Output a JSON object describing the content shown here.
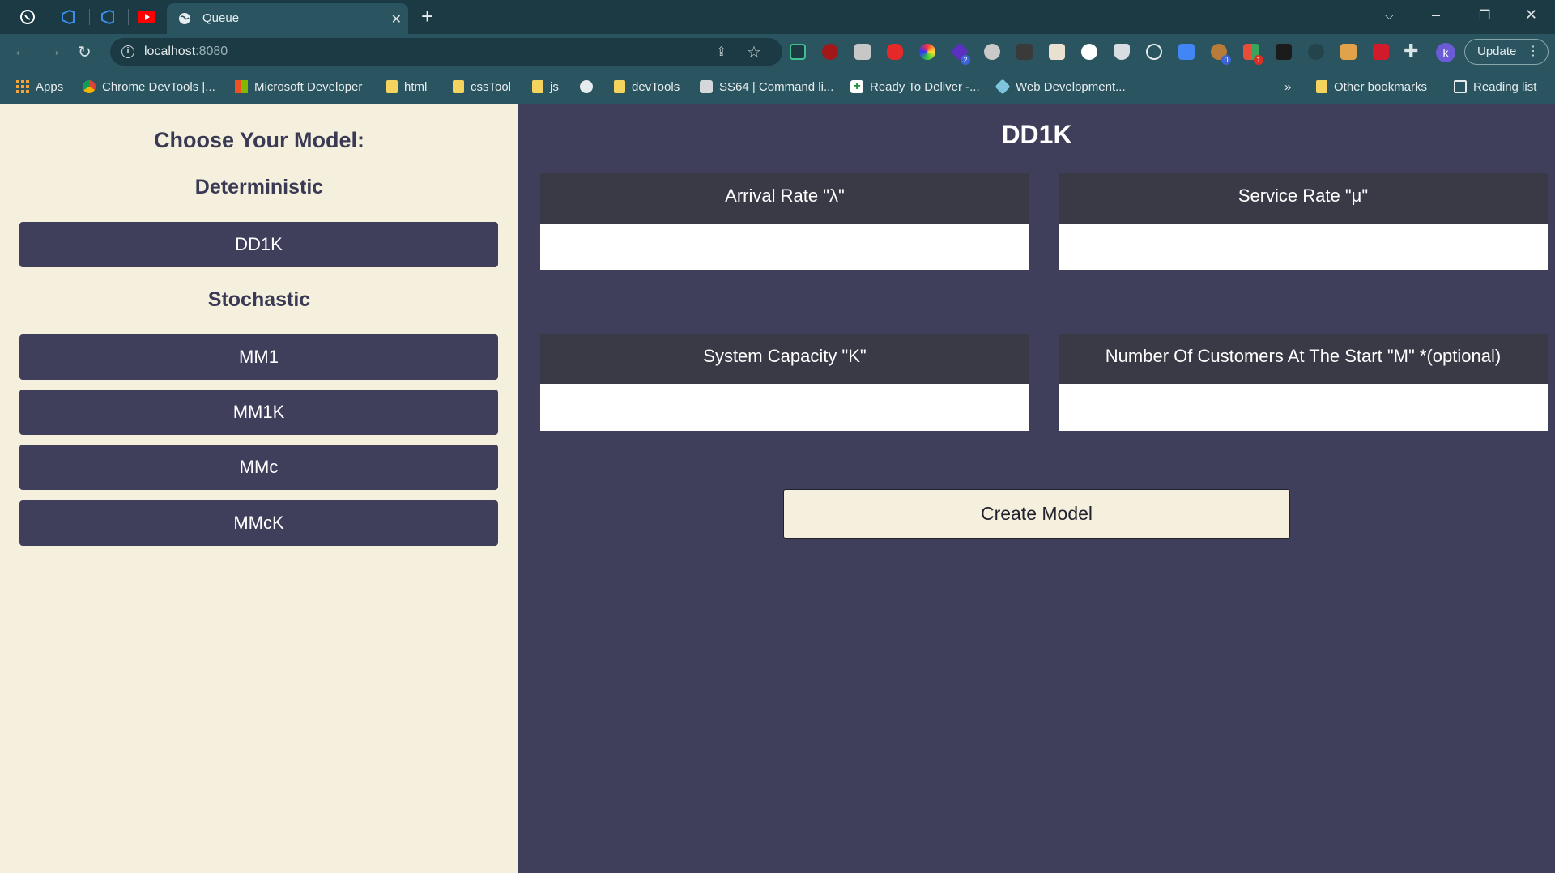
{
  "browser": {
    "tab_title": "Queue",
    "url_host": "localhost",
    "url_port": ":8080",
    "update_label": "Update",
    "profile_initial": "k",
    "extension_badges": [
      "2",
      "0",
      "1"
    ],
    "bookmarks": [
      {
        "label": "Apps",
        "kind": "apps"
      },
      {
        "label": "Chrome DevTools |...",
        "kind": "chrome"
      },
      {
        "label": "Microsoft Developer",
        "kind": "microsoft"
      },
      {
        "label": "html",
        "kind": "folder"
      },
      {
        "label": "cssTool",
        "kind": "folder"
      },
      {
        "label": "js",
        "kind": "folder"
      },
      {
        "label": "",
        "kind": "globe"
      },
      {
        "label": "devTools",
        "kind": "folder"
      },
      {
        "label": "SS64 | Command li...",
        "kind": "page"
      },
      {
        "label": "Ready To Deliver -...",
        "kind": "plus"
      },
      {
        "label": "Web Development...",
        "kind": "cube"
      }
    ],
    "more_bookmarks": "»",
    "other_bookmarks": "Other bookmarks",
    "reading_list": "Reading list"
  },
  "sidebar": {
    "heading": "Choose Your Model:",
    "deterministic_label": "Deterministic",
    "deterministic_models": [
      "DD1K"
    ],
    "stochastic_label": "Stochastic",
    "stochastic_models": [
      "MM1",
      "MM1K",
      "MMc",
      "MMcK"
    ]
  },
  "main": {
    "title": "DD1K",
    "fields": [
      {
        "label": "Arrival Rate \"λ\"",
        "value": ""
      },
      {
        "label": "Service Rate \"μ\"",
        "value": ""
      },
      {
        "label": "System Capacity \"K\"",
        "value": ""
      },
      {
        "label": "Number Of Customers At The Start \"M\" *(optional)",
        "value": ""
      }
    ],
    "create_button": "Create Model"
  },
  "colors": {
    "sidebar_bg": "#f5f0dd",
    "main_bg": "#3f3f5c",
    "label_bg": "#3a3a47",
    "browser_bg": "#2a5560"
  }
}
